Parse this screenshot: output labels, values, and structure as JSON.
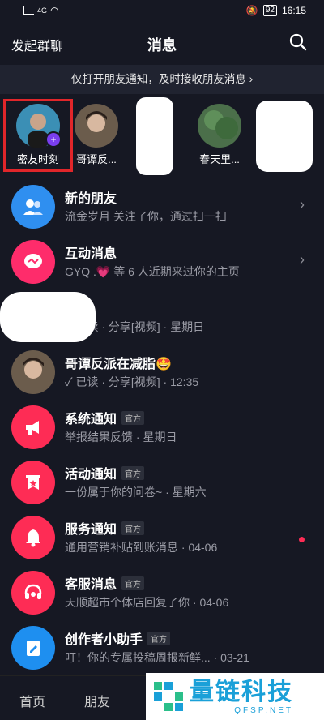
{
  "status": {
    "time": "16:15",
    "battery": "92",
    "net": "4G"
  },
  "nav": {
    "left": "发起群聊",
    "title": "消息"
  },
  "banner": {
    "text": "仅打开朋友通知，及时接收朋友消息 ›"
  },
  "stories": [
    {
      "label": "密友时刻",
      "color": "#3b8fb5"
    },
    {
      "label": "哥谭反...",
      "color": "#6b5c4c"
    },
    {
      "label": "",
      "color": "#7a8a72"
    },
    {
      "label": "春天里...",
      "color": "#4b6f4a"
    },
    {
      "label": "",
      "color": "#2d3a2d"
    }
  ],
  "rows": [
    {
      "title": "新的朋友",
      "sub": "流金岁月 关注了你，通过扫一扫",
      "icon": "people-icon",
      "bg": "#2f8ff0",
      "chevron": "›"
    },
    {
      "title": "互动消息",
      "sub": "GYQ .💗 等 6 人近期来过你的主页",
      "icon": "message-icon",
      "bg": "#fe2c6b",
      "chevron": "›"
    },
    {
      "title": "",
      "sub": "✓ 已读 · 分享[视频] · 星期日",
      "icon": "avatar-hidden",
      "bg": "#cfcfcf"
    },
    {
      "title": "哥谭反派在减脂🤩",
      "sub": "✓ 已读 · 分享[视频] · 12:35",
      "icon": "avatar-photo",
      "bg": "#6b5c4c"
    },
    {
      "title": "系统通知",
      "tag": "官方",
      "sub": "举报结果反馈 · 星期日",
      "icon": "megaphone-icon",
      "bg": "#fe2c55"
    },
    {
      "title": "活动通知",
      "tag": "官方",
      "sub": "一份属于你的问卷~ · 星期六",
      "icon": "star-bookmark-icon",
      "bg": "#fe2c55"
    },
    {
      "title": "服务通知",
      "tag": "官方",
      "sub": "通用营销补贴到账消息 · 04-06",
      "icon": "bell-icon",
      "bg": "#fe2c55",
      "unread": "dot"
    },
    {
      "title": "客服消息",
      "tag": "官方",
      "sub": "天顺超市个体店回复了你 · 04-06",
      "icon": "headset-icon",
      "bg": "#fe2c55"
    },
    {
      "title": "创作者小助手",
      "tag": "官方",
      "sub": "叮！你的专属投稿周报新鲜... · 03-21",
      "icon": "edit-icon",
      "bg": "#1e8ff0"
    }
  ],
  "tabs": [
    "首页",
    "朋友"
  ],
  "watermark": {
    "big": "量链科技",
    "small": "QFSP.NET"
  }
}
